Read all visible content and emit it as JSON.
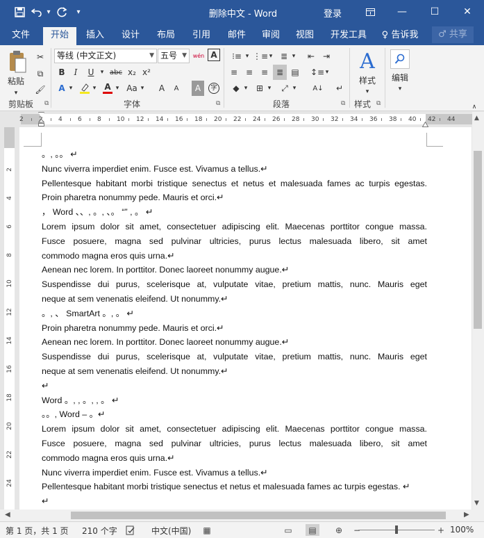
{
  "window": {
    "title": "删除中文 - Word",
    "login": "登录",
    "minimize": "—",
    "maximize": "☐",
    "close": "✕",
    "restore_ribbon": "⧉"
  },
  "qat": {
    "save": "💾",
    "undo": "↶",
    "undo_dropdown": "▾",
    "redo": "↻",
    "customize": "▾"
  },
  "tabs": [
    "文件",
    "开始",
    "插入",
    "设计",
    "布局",
    "引用",
    "邮件",
    "审阅",
    "视图",
    "开发工具"
  ],
  "active_tab": "开始",
  "tell_me": "♀ 告诉我",
  "share": "♂ 共享",
  "ribbon": {
    "clipboard": {
      "label": "剪贴板",
      "paste": "粘贴"
    },
    "font": {
      "label": "字体",
      "font_name": "等线 (中文正文)",
      "font_size": "五号",
      "bold": "B",
      "italic": "I",
      "underline": "U",
      "strike": "abc",
      "subscript": "x₂",
      "superscript": "x²",
      "case": "Aa",
      "grow": "A",
      "shrink": "A",
      "clear": "A",
      "wen": "wén",
      "border_char": "A",
      "circle_char": "字"
    },
    "paragraph": {
      "label": "段落"
    },
    "styles": {
      "label": "样式",
      "styles_btn": "样式"
    },
    "editing": {
      "label": "编辑",
      "editing_btn": "编辑"
    }
  },
  "ruler": {
    "numbers": [
      "2",
      "2",
      "4",
      "6",
      "8",
      "10",
      "12",
      "14",
      "16",
      "18",
      "20",
      "22",
      "24",
      "26",
      "28",
      "30",
      "32",
      "34",
      "36",
      "38",
      "40",
      "42",
      "44"
    ],
    "vnumbers": [
      "2",
      "4",
      "6",
      "8",
      "10",
      "12",
      "14",
      "16",
      "18",
      "20",
      "22",
      "24"
    ],
    "tab_stop": "L"
  },
  "document": {
    "lines": [
      "。, 。。 ↵",
      "Nunc viverra imperdiet enim. Fusce est. Vivamus a tellus.↵",
      "Pellentesque habitant morbi tristique senectus et netus et malesuada fames ac turpis egestas.",
      "Proin pharetra nonummy pede. Mauris et orci.↵",
      "，  Word  、、, 。, 、。  “” , 。 ↵",
      "Lorem ipsum dolor sit amet, consectetuer adipiscing elit. Maecenas porttitor congue massa.",
      "Fusce posuere, magna sed pulvinar ultricies, purus lectus malesuada libero, sit amet",
      "commodo magna eros quis urna.↵",
      "Aenean nec lorem. In porttitor. Donec laoreet nonummy augue.↵",
      "Suspendisse dui purus, scelerisque at, vulputate vitae, pretium mattis, nunc. Mauris eget",
      "neque at sem venenatis eleifend. Ut nonummy.↵",
      "。, 、   SmartArt  。, 。 ↵",
      "Proin pharetra nonummy pede. Mauris et orci.↵",
      "Aenean nec lorem. In porttitor. Donec laoreet nonummy augue.↵",
      "Suspendisse dui purus, scelerisque at, vulputate vitae, pretium mattis, nunc. Mauris eget",
      "neque at sem venenatis eleifend. Ut nonummy.↵",
      "↵",
      "  Word  。, , 。, , 。 ↵",
      "。。,  Word    –  。↵",
      "Lorem ipsum dolor sit amet, consectetuer adipiscing elit. Maecenas porttitor congue massa.",
      "Fusce posuere, magna sed pulvinar ultricies, purus lectus malesuada libero, sit amet",
      "commodo magna eros quis urna.↵",
      "Nunc viverra imperdiet enim. Fusce est. Vivamus a tellus.↵",
      "Pellentesque habitant morbi tristique senectus et netus et malesuada fames ac turpis egestas.  ↵",
      "↵"
    ]
  },
  "status": {
    "page": "第 1 页，共 1 页",
    "words": "210 个字",
    "language": "中文(中国)",
    "zoom_minus": "−",
    "zoom_plus": "+",
    "zoom": "100%"
  }
}
